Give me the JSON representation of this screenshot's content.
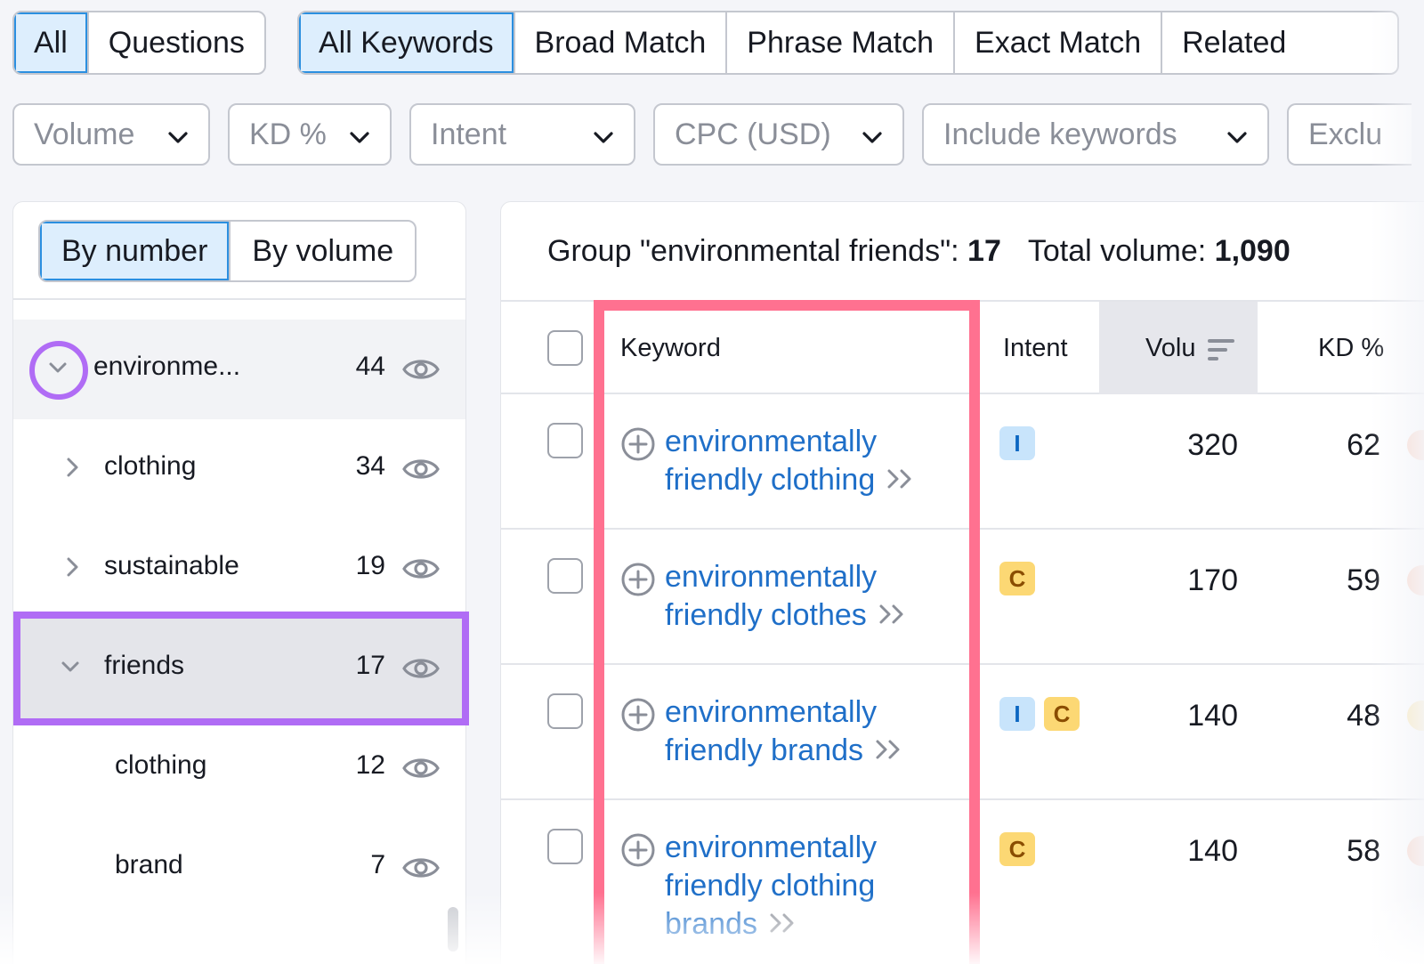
{
  "tabs_primary": [
    {
      "label": "All",
      "active": true
    },
    {
      "label": "Questions",
      "active": false
    }
  ],
  "tabs_match": [
    {
      "label": "All Keywords",
      "active": true
    },
    {
      "label": "Broad Match",
      "active": false
    },
    {
      "label": "Phrase Match",
      "active": false
    },
    {
      "label": "Exact Match",
      "active": false
    },
    {
      "label": "Related",
      "active": false
    }
  ],
  "filters": [
    "Volume",
    "KD %",
    "Intent",
    "CPC (USD)",
    "Include keywords",
    "Exclu"
  ],
  "left_panel": {
    "sort_options": [
      {
        "label": "By number",
        "active": true
      },
      {
        "label": "By volume",
        "active": false
      }
    ],
    "groups": [
      {
        "label": "environme...",
        "count": "44"
      },
      {
        "label": "clothing",
        "count": "34"
      },
      {
        "label": "sustainable",
        "count": "19"
      },
      {
        "label": "friends",
        "count": "17"
      },
      {
        "label": "clothing",
        "count": "12"
      },
      {
        "label": "brand",
        "count": "7"
      }
    ]
  },
  "summary": {
    "group_label": "Group \"environmental friends\":",
    "group_count": "17",
    "total_label": "Total volume:",
    "total_value": "1,090"
  },
  "table": {
    "columns": {
      "keyword": "Keyword",
      "intent": "Intent",
      "volume": "Volu",
      "kd": "KD %"
    },
    "rows": [
      {
        "keyword": "environmentally friendly clothing",
        "intents": [
          "I"
        ],
        "volume": "320",
        "kd": "62",
        "kd_color": "#fbd3c4"
      },
      {
        "keyword": "environmentally friendly clothes",
        "intents": [
          "C"
        ],
        "volume": "170",
        "kd": "59",
        "kd_color": "#fbd3c4"
      },
      {
        "keyword": "environmentally friendly brands",
        "intents": [
          "I",
          "C"
        ],
        "volume": "140",
        "kd": "48",
        "kd_color": "#fbe7b0"
      },
      {
        "keyword": "environmentally friendly clothing brands",
        "intents": [
          "C"
        ],
        "volume": "140",
        "kd": "58",
        "kd_color": "#fbd3c4"
      }
    ]
  },
  "colors": {
    "active_tab_bg": "#ddeefd",
    "active_tab_border": "#2b8fe0",
    "purple_highlight": "#b06cf5",
    "pink_highlight": "#ff7190",
    "link": "#1f6fc8"
  },
  "icons": [
    "chevron-down-icon",
    "chevron-right-icon",
    "eye-icon",
    "plus-circle-icon",
    "double-chevron-icon",
    "sort-icon"
  ]
}
